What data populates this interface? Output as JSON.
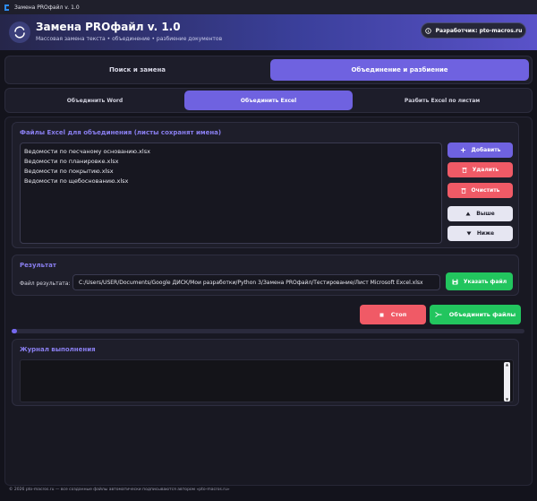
{
  "window": {
    "title": "Замена PROфайл v. 1.0"
  },
  "header": {
    "title": "Замена PROфайл v. 1.0",
    "subtitle": "Массовая замена текста  •  объединение  •  разбиение документов",
    "dev_button": "Разработчик: pto-macros.ru"
  },
  "main_tabs": [
    {
      "label": "Поиск и замена",
      "active": false
    },
    {
      "label": "Объединение и разбиение",
      "active": true
    }
  ],
  "sub_tabs": [
    {
      "label": "Объединить Word",
      "active": false
    },
    {
      "label": "Объединить Excel",
      "active": true
    },
    {
      "label": "Разбить Excel по листам",
      "active": false
    }
  ],
  "files_card": {
    "title": "Файлы Excel для объединения (листы сохранят имена)",
    "files": [
      "Ведомости по песчаному основанию.xlsx",
      "Ведомости по планировке.xlsx",
      "Ведомости по покрытию.xlsx",
      "Ведомости по щебоснованию.xlsx"
    ],
    "buttons": {
      "add": "Добавить",
      "delete": "Удалить",
      "clear": "Очистить",
      "up": "Выше",
      "down": "Ниже"
    }
  },
  "result_card": {
    "title": "Результат",
    "label": "Файл результата:",
    "path": "C:/Users/USER/Documents/Google ДИСК/Мои разработки/Python 3/Замена PROфайл/Тестирование/Лист Microsoft Excel.xlsx",
    "browse_button": "Указать файл"
  },
  "actions": {
    "stop": "Стоп",
    "merge": "Объединить файлы"
  },
  "progress": {
    "value": 0.01
  },
  "log_card": {
    "title": "Журнал выполнения"
  },
  "footer": "© 2026 pto-macros.ru — все созданные файлы автоматически подписываются автором «pto-macros.ru»",
  "colors": {
    "accent": "#6f62e0",
    "danger": "#f05a66",
    "success": "#22c55e",
    "background": "#13131c"
  }
}
